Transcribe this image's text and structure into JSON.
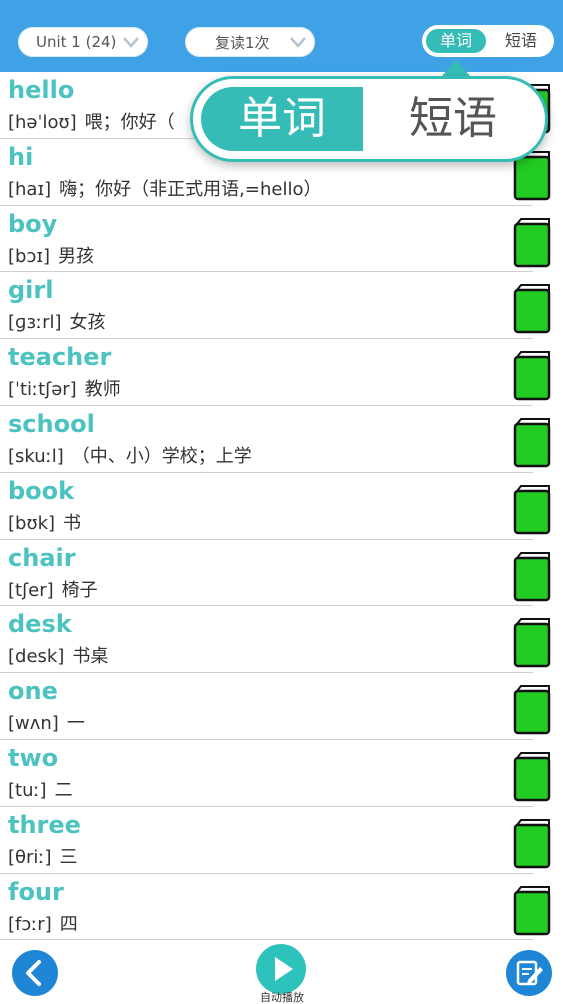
{
  "header": {
    "unit_select": "Unit 1 (24)",
    "repeat_select": "复读1次",
    "toggle": {
      "active": "单词",
      "inactive": "短语"
    }
  },
  "popup": {
    "active": "单词",
    "inactive": "短语"
  },
  "words": [
    {
      "word": "hello",
      "phonetic": "[həˈloʊ]",
      "meaning": "喂；你好（"
    },
    {
      "word": "hi",
      "phonetic": "[haɪ]",
      "meaning": "嗨；你好（非正式用语,=hello）"
    },
    {
      "word": "boy",
      "phonetic": "[bɔɪ]",
      "meaning": "男孩"
    },
    {
      "word": "girl",
      "phonetic": "[ɡɜːrl]",
      "meaning": "女孩"
    },
    {
      "word": "teacher",
      "phonetic": "[ˈtiːtʃər]",
      "meaning": "教师"
    },
    {
      "word": "school",
      "phonetic": "[skuːl]",
      "meaning": "（中、小）学校；上学"
    },
    {
      "word": "book",
      "phonetic": "[bʊk]",
      "meaning": "书"
    },
    {
      "word": "chair",
      "phonetic": "[tʃer]",
      "meaning": "椅子"
    },
    {
      "word": "desk",
      "phonetic": "[desk]",
      "meaning": "书桌"
    },
    {
      "word": "one",
      "phonetic": "[wʌn]",
      "meaning": "一"
    },
    {
      "word": "two",
      "phonetic": "[tuː]",
      "meaning": "二"
    },
    {
      "word": "three",
      "phonetic": "[θriː]",
      "meaning": "三"
    },
    {
      "word": "four",
      "phonetic": "[fɔːr]",
      "meaning": "四"
    }
  ],
  "bottom": {
    "play_label": "自动播放"
  },
  "colors": {
    "header": "#3fa2e6",
    "accent": "#36bcb7",
    "word": "#4cc3c0",
    "book": "#22cc22"
  }
}
